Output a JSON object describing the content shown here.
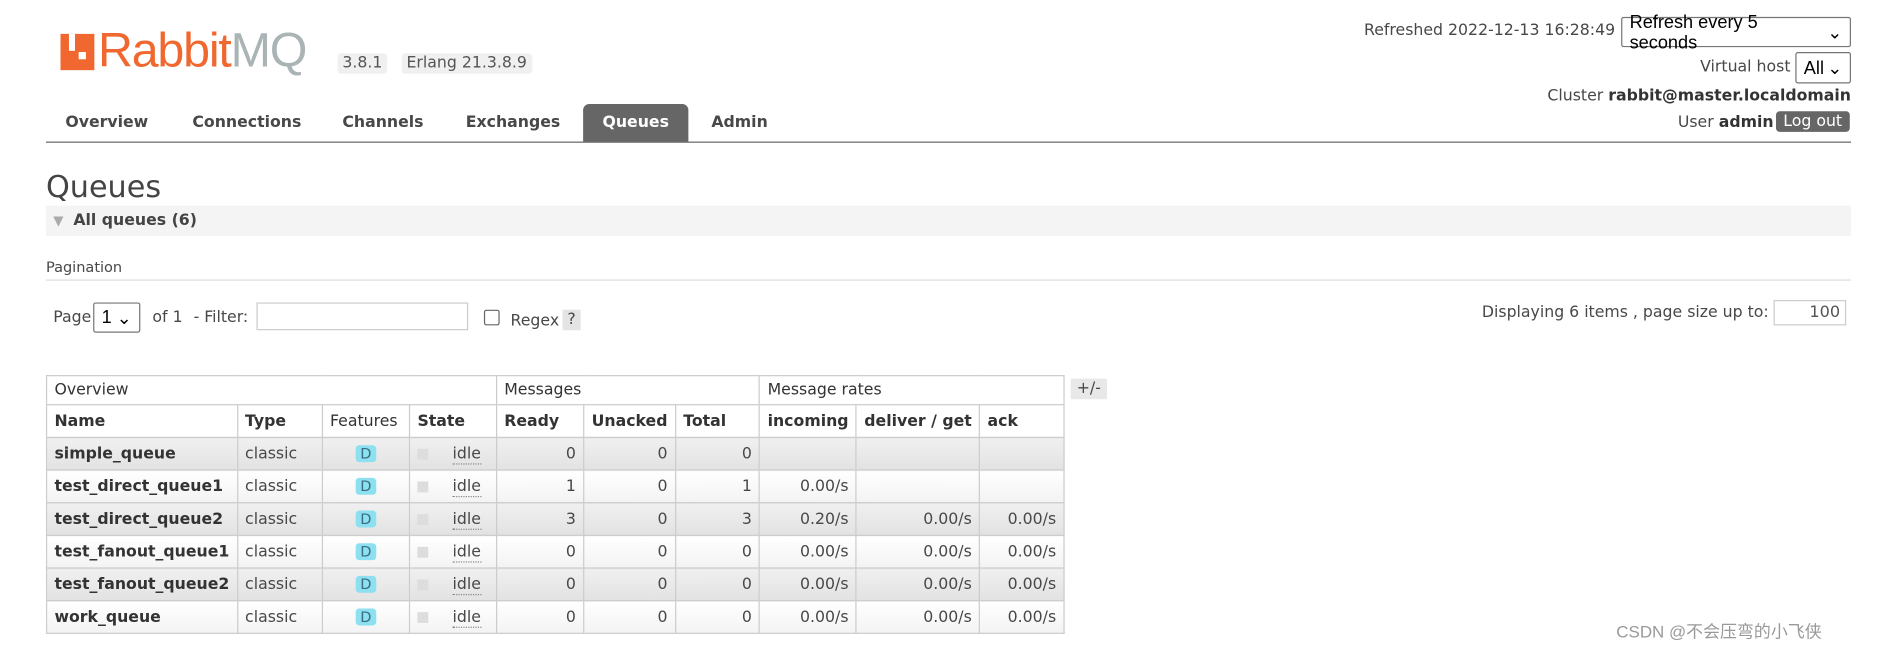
{
  "header": {
    "logo_text": "RabbitMQ",
    "logo_part1": "Rabbit",
    "logo_part2": "MQ",
    "version": "3.8.1",
    "erlang": "Erlang 21.3.8.9",
    "refreshed_label": "Refreshed 2022-12-13 16:28:49",
    "refresh_select": "Refresh every 5 seconds",
    "vhost_label": "Virtual host",
    "vhost_select": "All",
    "cluster_label": "Cluster",
    "cluster_name": "rabbit@master.localdomain",
    "user_label": "User",
    "user_name": "admin",
    "logout": "Log out"
  },
  "nav": {
    "tabs": [
      {
        "label": "Overview"
      },
      {
        "label": "Connections"
      },
      {
        "label": "Channels"
      },
      {
        "label": "Exchanges"
      },
      {
        "label": "Queues",
        "active": true
      },
      {
        "label": "Admin"
      }
    ]
  },
  "page": {
    "title": "Queues",
    "section": "All queues (6)",
    "pagination_label": "Pagination",
    "page_label": "Page",
    "page_value": "1",
    "of_label": "of 1",
    "filter_label": "- Filter:",
    "filter_value": "",
    "regex_label": "Regex",
    "help": "?",
    "displaying": "Displaying 6 items , page size up to:",
    "page_size": "100"
  },
  "table": {
    "groups": [
      "Overview",
      "Messages",
      "Message rates"
    ],
    "toggle": "+/-",
    "columns": [
      "Name",
      "Type",
      "Features",
      "State",
      "Ready",
      "Unacked",
      "Total",
      "incoming",
      "deliver / get",
      "ack"
    ],
    "rows": [
      {
        "name": "simple_queue",
        "type": "classic",
        "features": "D",
        "state": "idle",
        "ready": "0",
        "unacked": "0",
        "total": "0",
        "incoming": "",
        "deliver": "",
        "ack": ""
      },
      {
        "name": "test_direct_queue1",
        "type": "classic",
        "features": "D",
        "state": "idle",
        "ready": "1",
        "unacked": "0",
        "total": "1",
        "incoming": "0.00/s",
        "deliver": "",
        "ack": ""
      },
      {
        "name": "test_direct_queue2",
        "type": "classic",
        "features": "D",
        "state": "idle",
        "ready": "3",
        "unacked": "0",
        "total": "3",
        "incoming": "0.20/s",
        "deliver": "0.00/s",
        "ack": "0.00/s"
      },
      {
        "name": "test_fanout_queue1",
        "type": "classic",
        "features": "D",
        "state": "idle",
        "ready": "0",
        "unacked": "0",
        "total": "0",
        "incoming": "0.00/s",
        "deliver": "0.00/s",
        "ack": "0.00/s"
      },
      {
        "name": "test_fanout_queue2",
        "type": "classic",
        "features": "D",
        "state": "idle",
        "ready": "0",
        "unacked": "0",
        "total": "0",
        "incoming": "0.00/s",
        "deliver": "0.00/s",
        "ack": "0.00/s"
      },
      {
        "name": "work_queue",
        "type": "classic",
        "features": "D",
        "state": "idle",
        "ready": "0",
        "unacked": "0",
        "total": "0",
        "incoming": "0.00/s",
        "deliver": "0.00/s",
        "ack": "0.00/s"
      }
    ]
  },
  "watermark": "CSDN @不会压弯的小飞侠",
  "colors": {
    "brand_orange": "#f06830",
    "tab_active": "#666666",
    "feature_badge": "#8ce0f0"
  }
}
